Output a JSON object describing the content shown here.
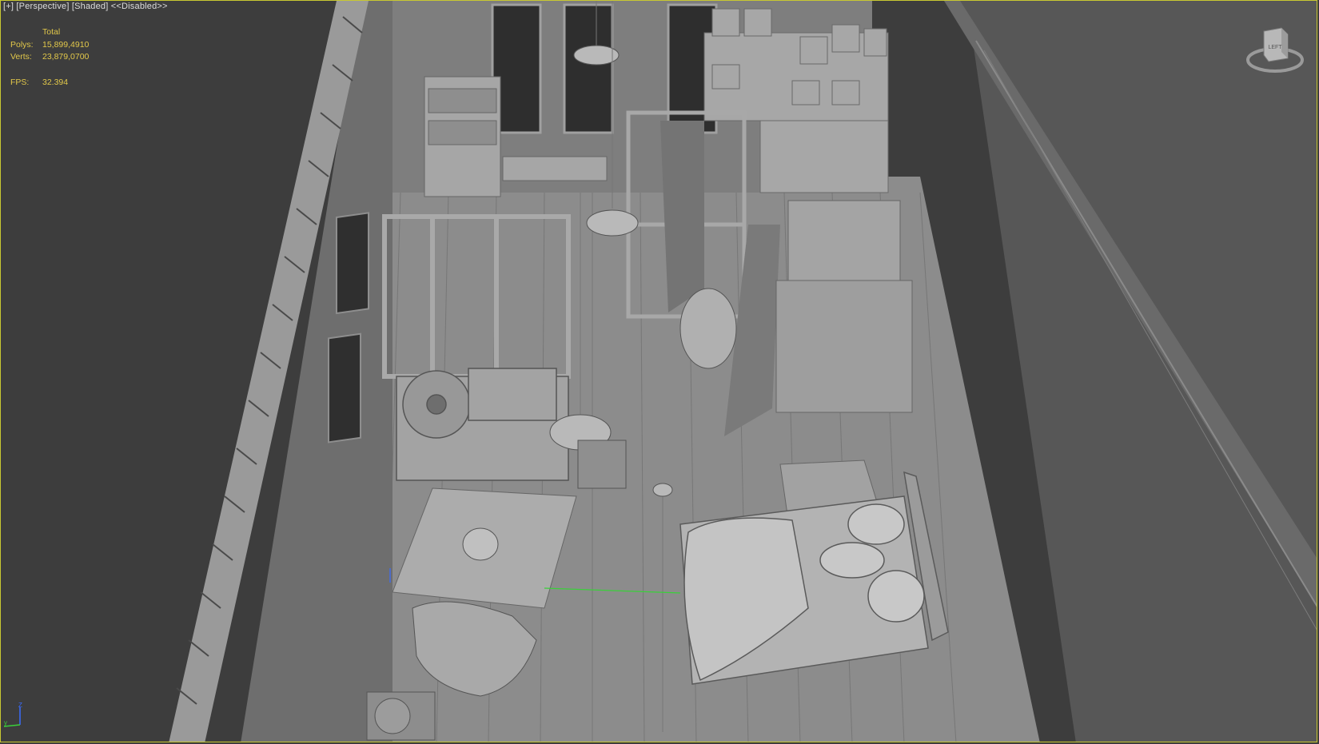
{
  "viewport": {
    "menu_label": "[+]",
    "view_label": "[Perspective]",
    "shading_label": "[Shaded]",
    "mode_label": "<<Disabled>>"
  },
  "stats": {
    "header": "Total",
    "polys_label": "Polys:",
    "polys_value": "15,899,4910",
    "verts_label": "Verts:",
    "verts_value": "23,879,0700",
    "fps_label": "FPS:",
    "fps_value": "32.394"
  },
  "viewcube": {
    "face_label": "LEFT"
  },
  "axis": {
    "z": "Z",
    "y": "y"
  },
  "colors": {
    "background": "#3c3c3c",
    "viewport_border": "#c8c832",
    "stats_text": "#e2c84a",
    "model_gray": "#9a9a9a",
    "axis_green": "#3ad03a",
    "axis_blue": "#3a6cff"
  },
  "icons": [
    "viewcube-icon",
    "axis-tripod-icon",
    "world-grid-axis-icon"
  ]
}
